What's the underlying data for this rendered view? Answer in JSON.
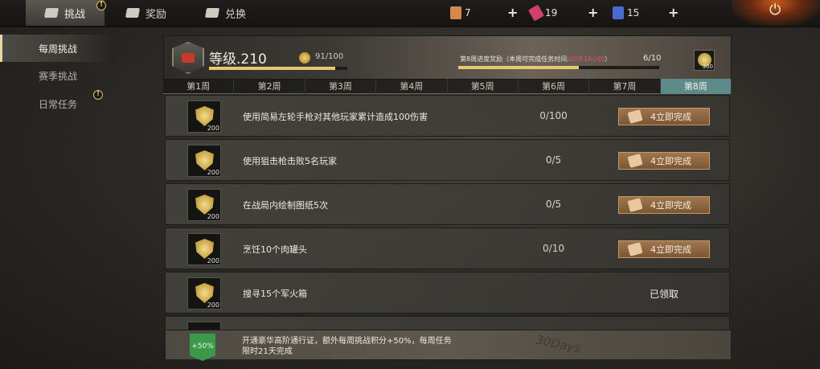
{
  "topbar": {
    "tabs": [
      {
        "label": "挑战",
        "alert": "!"
      },
      {
        "label": "奖励"
      },
      {
        "label": "兑换"
      }
    ],
    "resources": [
      {
        "name": "ticket-icon",
        "value": "7",
        "color": "#d4884a"
      },
      {
        "name": "pass-card-icon",
        "value": "19",
        "color": "#d0406a"
      },
      {
        "name": "blue-card-icon",
        "value": "15",
        "color": "#4a6ad0"
      }
    ],
    "plus": "+",
    "power": "⏻"
  },
  "sidebar": {
    "items": [
      {
        "label": "每周挑战"
      },
      {
        "label": "赛季挑战"
      },
      {
        "label": "日常任务",
        "alert": "!"
      }
    ]
  },
  "header": {
    "level": "等级.210",
    "xp": "91/100",
    "xp_fraction": 0.91,
    "progress_label": "第8周进度奖励（本周可完成任务时间:",
    "progress_time": "20天16小时",
    "progress_close": "）",
    "progress": "6/10",
    "progress_fraction": 0.6,
    "reward_count": "300"
  },
  "weeks": [
    "第1周",
    "第2周",
    "第3周",
    "第4周",
    "第5周",
    "第6周",
    "第7周",
    "第8周"
  ],
  "tasks": [
    {
      "reward": "200",
      "desc": "使用简易左轮手枪对其他玩家累计造成100伤害",
      "progress": "0/100",
      "action": "4立即完成"
    },
    {
      "reward": "200",
      "desc": "使用狙击枪击败5名玩家",
      "progress": "0/5",
      "action": "4立即完成"
    },
    {
      "reward": "200",
      "desc": "在战局内绘制图纸5次",
      "progress": "0/5",
      "action": "4立即完成"
    },
    {
      "reward": "200",
      "desc": "烹饪10个肉罐头",
      "progress": "0/10",
      "action": "4立即完成"
    },
    {
      "reward": "200",
      "desc": "搜寻15个军火箱",
      "progress": "",
      "status": "已领取"
    }
  ],
  "banner": {
    "badge": "+50%",
    "text": "开通豪华高阶通行证，额外每周挑战积分+50%，每周任务限时21天完成",
    "watermark": "30Days"
  }
}
